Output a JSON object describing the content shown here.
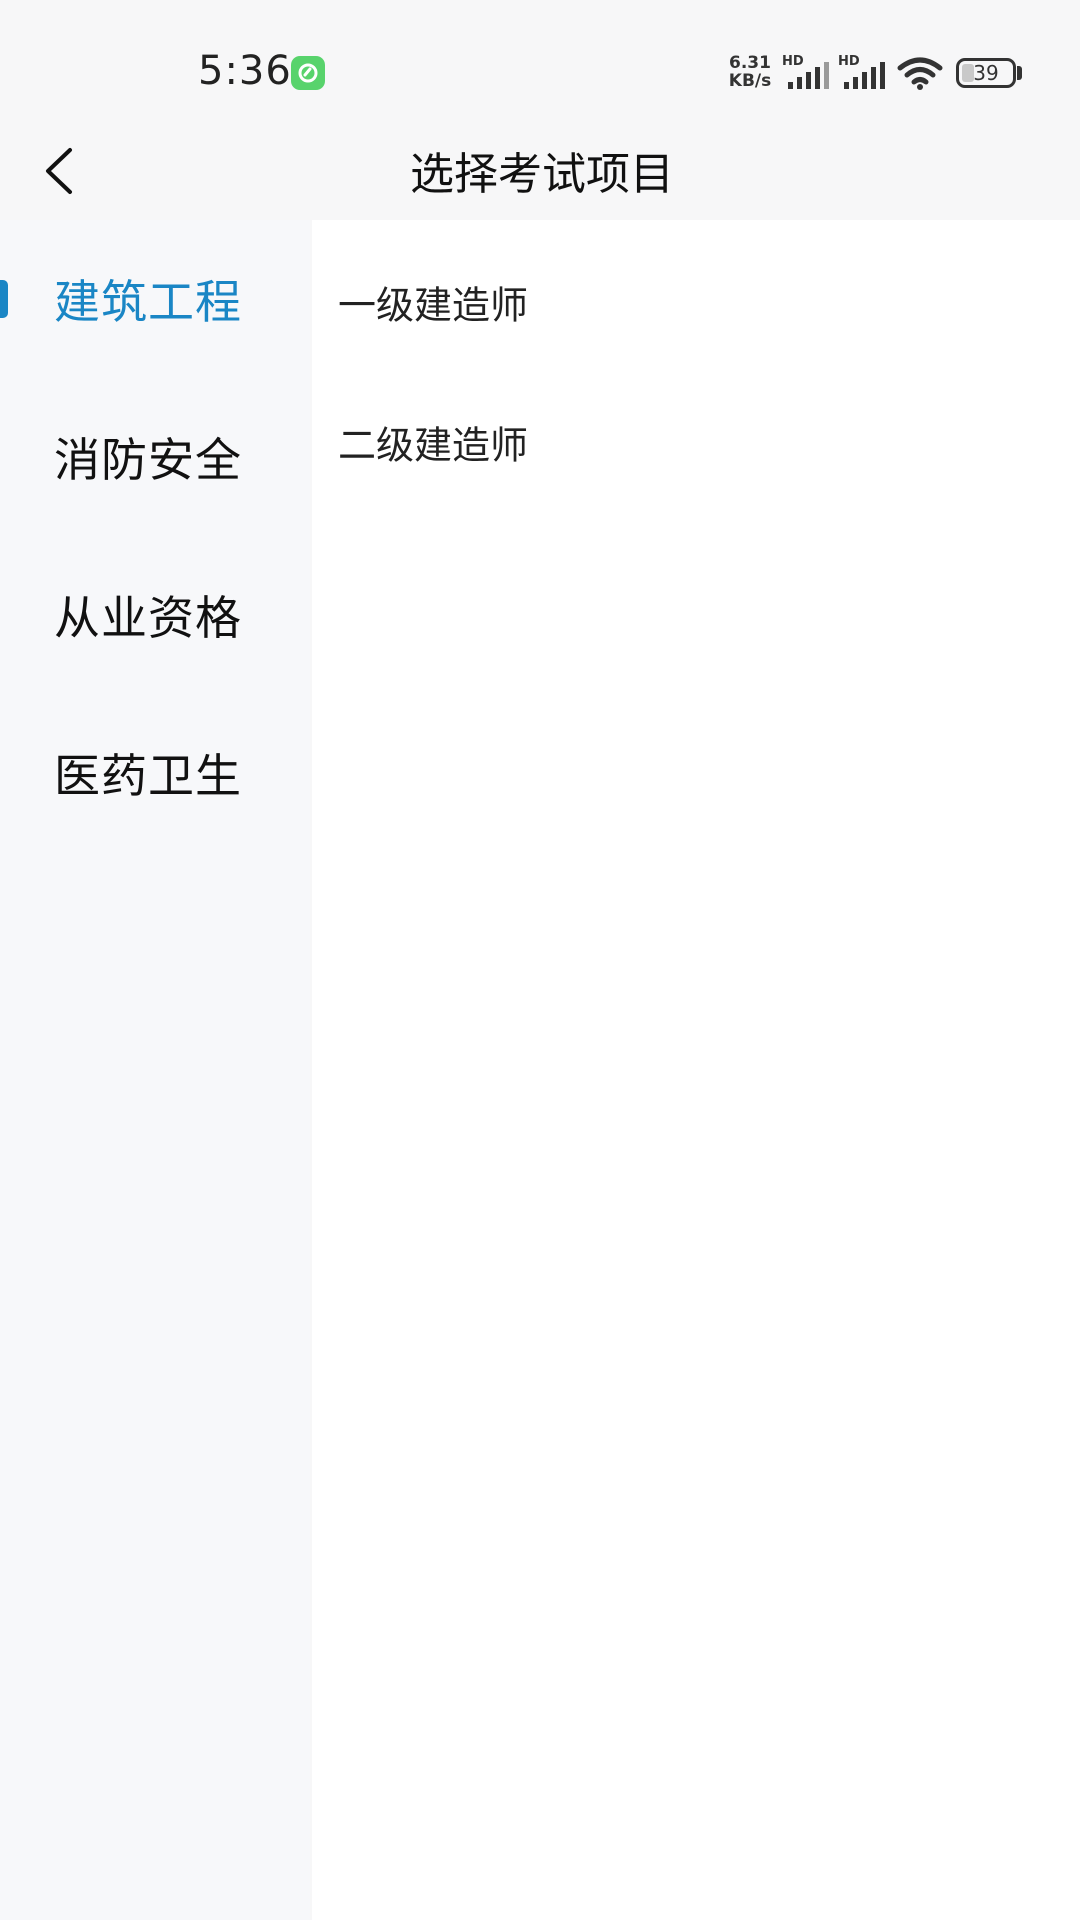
{
  "status_bar": {
    "time": "5:36",
    "net_speed_value": "6.31",
    "net_speed_unit": "KB/s",
    "signal_1_label": "HD",
    "signal_2_label": "HD",
    "battery_level": "39",
    "app_badge_color": "#58d36c",
    "icons": [
      "app-notification-icon",
      "signal-icon",
      "signal-icon",
      "wifi-icon",
      "battery-icon"
    ]
  },
  "header": {
    "back_icon": "chevron-left-icon",
    "title": "选择考试项目"
  },
  "sidebar": {
    "items": [
      {
        "label": "建筑工程",
        "active": true
      },
      {
        "label": "消防安全",
        "active": false
      },
      {
        "label": "从业资格",
        "active": false
      },
      {
        "label": "医药卫生",
        "active": false
      }
    ]
  },
  "content": {
    "items": [
      {
        "label": "一级建造师"
      },
      {
        "label": "二级建造师"
      }
    ]
  },
  "colors": {
    "accent": "#1a86c5",
    "sidebar_bg": "#f7f8fa",
    "content_bg": "#ffffff",
    "header_bg": "#f7f7f8"
  }
}
